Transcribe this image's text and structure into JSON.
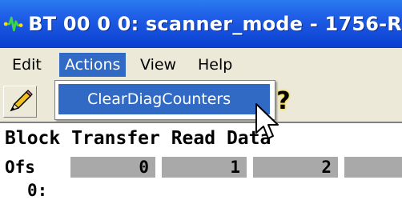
{
  "window": {
    "title": "BT 00 0 0: scanner_mode - 1756-R"
  },
  "menubar": {
    "items": [
      {
        "label": "Edit"
      },
      {
        "label": "Actions"
      },
      {
        "label": "View"
      },
      {
        "label": "Help"
      }
    ]
  },
  "actions_menu": {
    "items": [
      {
        "label": "ClearDiagCounters"
      }
    ]
  },
  "toolbar": {
    "icons": [
      "pencil-icon",
      "help-icon"
    ],
    "help_glyph": "?"
  },
  "content": {
    "heading": "Block Transfer Read Data",
    "header_row": {
      "label": "Ofs",
      "columns": [
        "0",
        "1",
        "2"
      ]
    },
    "row_label": "0:"
  },
  "colors": {
    "titlebar": "#0a3fcf",
    "menu_highlight": "#316ac5",
    "header_cell": "#a9a9a9",
    "chrome": "#ece9d8"
  }
}
